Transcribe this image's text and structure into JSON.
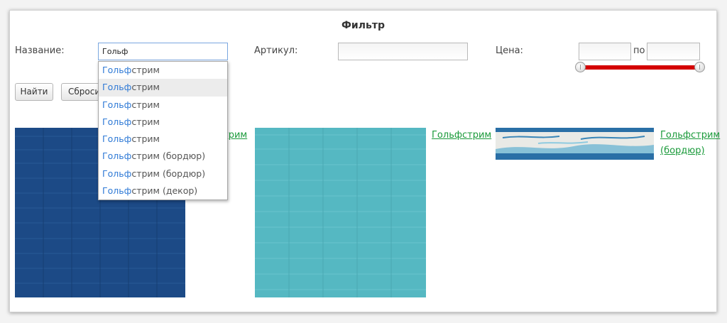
{
  "filter": {
    "title": "Фильтр",
    "name_label": "Название:",
    "name_value": "Гольф",
    "article_label": "Артикул:",
    "article_value": "",
    "price_label": "Цена:",
    "price_from": "",
    "price_to_label": "по",
    "price_to": "",
    "price_slider": {
      "min_fraction": 0.0,
      "max_fraction": 1.0,
      "track_color": "#d40000"
    }
  },
  "buttons": {
    "find": "Найти",
    "reset": "Сбросить"
  },
  "autocomplete": [
    {
      "match": "Гольф",
      "rest": "стрим"
    },
    {
      "match": "Гольф",
      "rest": "стрим"
    },
    {
      "match": "Гольф",
      "rest": "стрим"
    },
    {
      "match": "Гольф",
      "rest": "стрим"
    },
    {
      "match": "Гольф",
      "rest": "стрим"
    },
    {
      "match": "Гольф",
      "rest": "стрим (бордюр)"
    },
    {
      "match": "Гольф",
      "rest": "стрим (бордюр)"
    },
    {
      "match": "Гольф",
      "rest": "стрим (декор)"
    }
  ],
  "autocomplete_highlighted_index": 1,
  "products": [
    {
      "link": "Гольфстрим",
      "color": "#1c4a86"
    },
    {
      "link": "Гольфстрим",
      "color": "#55b8c2"
    },
    {
      "link_line1": "Гольфстрим",
      "link_line2": "(бордюр)",
      "color": "#2a6fa6"
    }
  ],
  "colors": {
    "accent_link": "#1a9a3a",
    "match_highlight": "#2f7ad6"
  }
}
